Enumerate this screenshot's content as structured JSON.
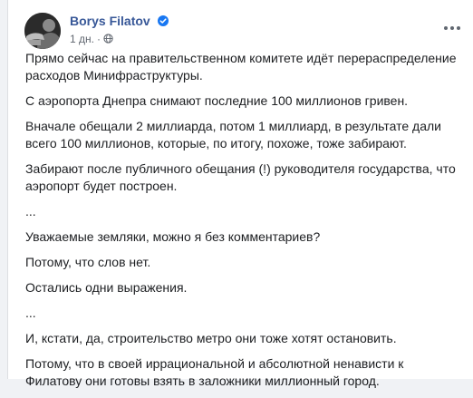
{
  "post": {
    "author": "Borys Filatov",
    "time": "1 дн.",
    "separator": "·",
    "paragraphs": [
      "Прямо сейчас на правительственном комитете идёт перераспределение расходов Минифраструктуры.",
      "С аэропорта Днепра снимают последние 100 миллионов гривен.",
      "Вначале обещали 2 миллиарда, потом 1 миллиард, в результате дали всего 100 миллионов, которые, по итогу, похоже, тоже забирают.",
      "Забирают после публичного обещания (!) руководителя государства, что аэропорт будет построен.",
      "...",
      "Уважаемые земляки, можно я без комментариев?",
      "Потому, что слов нет.",
      "Остались одни выражения.",
      "...",
      "И, кстати, да, строительство метро они тоже хотят остановить.",
      "Потому, что в своей иррациональной и абсолютной ненависти к Филатову они готовы взять в заложники миллионный город."
    ]
  },
  "icons": {
    "verified": "verified-badge-icon",
    "audience": "globe-icon",
    "more": "more-options-icon"
  },
  "colors": {
    "author_link": "#385898",
    "verified_badge": "#1877f2",
    "meta_text": "#616770",
    "body_text": "#1c1e21"
  }
}
